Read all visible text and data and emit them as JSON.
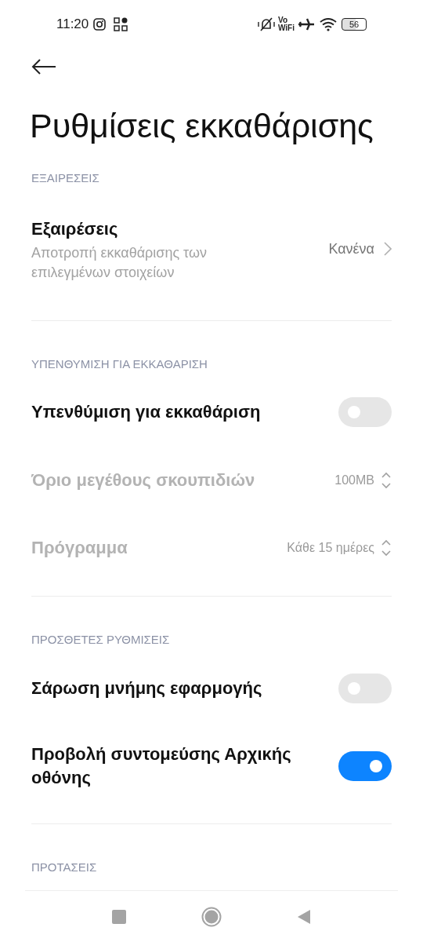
{
  "status_bar": {
    "time": "11:20",
    "vowifi_top": "Vo",
    "vowifi_bottom": "WiFi",
    "battery": "56"
  },
  "title": "Ρυθμίσεις εκκαθάρισης",
  "sections": [
    {
      "header": "ΕΞΑΙΡΕΣΕΙΣ",
      "items": [
        {
          "kind": "link",
          "label": "Εξαιρέσεις",
          "subtitle": "Αποτροπή εκκαθάρισης των επιλεγμένων στοιχείων",
          "value": "Κανένα",
          "disabled": false
        }
      ]
    },
    {
      "header": "ΥΠΕΝΘΥΜΙΣΗ ΓΙΑ ΕΚΚΑΘΑΡΙΣΗ",
      "items": [
        {
          "kind": "toggle",
          "label": "Υπενθύμιση για εκκαθάριση",
          "on": false,
          "disabled": false
        },
        {
          "kind": "stepper",
          "label": "Όριο μεγέθους σκουπιδιών",
          "value": "100MB",
          "disabled": true
        },
        {
          "kind": "stepper",
          "label": "Πρόγραμμα",
          "value": "Κάθε 15 ημέρες",
          "disabled": true
        }
      ]
    },
    {
      "header": "ΠΡΟΣΘΕΤΕΣ ΡΥΘΜΙΣΕΙΣ",
      "items": [
        {
          "kind": "toggle",
          "label": "Σάρωση μνήμης εφαρμογής",
          "on": false,
          "disabled": false
        },
        {
          "kind": "toggle",
          "label": "Προβολή συντομεύσης Αρχικής οθόνης",
          "on": true,
          "disabled": false
        }
      ]
    },
    {
      "header": "ΠΡΟΤΑΣΕΙΣ"
    }
  ]
}
